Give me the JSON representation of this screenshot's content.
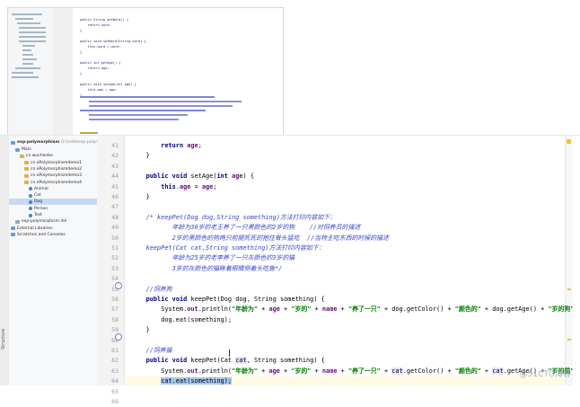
{
  "thumbnail": {
    "code_lines": [
      "public String getWord() {",
      "    return word;",
      "}",
      "public void setWord(String word) {",
      "    this.word = word;",
      "}",
      "public int getAge() {",
      "    return age;",
      "}",
      "public void setAge(int age) {",
      "    this.age = age;",
      "}"
    ]
  },
  "tree": {
    "project_name": "exp-polymorphism",
    "project_path": "D:\\code\\exp-polymorphism",
    "items": [
      {
        "label": "Main",
        "kind": "folder-blue",
        "indent": 1
      },
      {
        "label": "cn.wuchenbo",
        "kind": "folder",
        "indent": 2
      },
      {
        "label": "cn.ePolymorphismdemo1",
        "kind": "folder",
        "indent": 3
      },
      {
        "label": "cn.ePolymorphismdemo2",
        "kind": "folder",
        "indent": 3
      },
      {
        "label": "cn.ePolymorphismdemo3",
        "kind": "folder",
        "indent": 3
      },
      {
        "label": "cn.ePolymorphismdemo4",
        "kind": "folder",
        "indent": 3
      },
      {
        "label": "Animal",
        "kind": "class",
        "indent": 4
      },
      {
        "label": "Cat",
        "kind": "class",
        "indent": 4
      },
      {
        "label": "Dog",
        "kind": "class",
        "indent": 4,
        "selected": true
      },
      {
        "label": "Person",
        "kind": "class",
        "indent": 4
      },
      {
        "label": "Test",
        "kind": "class",
        "indent": 4
      },
      {
        "label": "exp-polymorphism.iml",
        "kind": "file",
        "indent": 1
      },
      {
        "label": "External Libraries",
        "kind": "folder-blue",
        "indent": 0
      },
      {
        "label": "Scratches and Consoles",
        "kind": "folder-blue",
        "indent": 0
      }
    ]
  },
  "side_label": "Structure",
  "editor": {
    "lines": [
      {
        "n": "41",
        "text": "        return age;"
      },
      {
        "n": "42",
        "text": "    }"
      },
      {
        "n": "43",
        "text": ""
      },
      {
        "n": "44",
        "text": "    public void setAge(int age) {"
      },
      {
        "n": "45",
        "text": "        this.age = age;"
      },
      {
        "n": "46",
        "text": "    }"
      },
      {
        "n": "47",
        "text": ""
      },
      {
        "n": "48",
        "text": "    /* keepPet(Dog dog,String something)方法打印内容如下："
      },
      {
        "n": "49",
        "text": "           年龄为30岁的老王养了一只黑颜色的2岁的狗    //对饲养员的描述"
      },
      {
        "n": "50",
        "text": "           2岁的黑颜色的狗两只前腿死死的抱住骨头猛吃  //当特主吃东西的时候的描述"
      },
      {
        "n": "51",
        "text": "    keepPet(Cat cat,String something)方法打印内容如下："
      },
      {
        "n": "52",
        "text": "           年龄为25岁的老李养了一只灰颜色的3岁的猫"
      },
      {
        "n": "53",
        "text": "           3岁的灰颜色的猫眯着眼睛侧着头吃鱼*/"
      },
      {
        "n": "54",
        "text": ""
      },
      {
        "n": "55",
        "text": "    //饲养狗"
      },
      {
        "n": "56",
        "text": "    public void keepPet(Dog dog, String something) {"
      },
      {
        "n": "57",
        "text": "        System.out.println(\"年龄为\" + age + \"岁的\" + name + \"养了一只\" + dog.getColor() + \"颜色的\" + dog.getAge() + \"岁的狗\");"
      },
      {
        "n": "58",
        "text": "        dog.eat(something);"
      },
      {
        "n": "59",
        "text": "    }"
      },
      {
        "n": "60",
        "text": ""
      },
      {
        "n": "61",
        "text": "    //饲养猫"
      },
      {
        "n": "62",
        "text": "    public void keepPet(Cat cat, String something) {"
      },
      {
        "n": "63",
        "text": "        System.out.println(\"年龄为\" + age + \"岁的\" + name + \"养了一只\" + cat.getColor() + \"颜色的\" + cat.getAge() + \"岁的猫\");"
      },
      {
        "n": "64",
        "text": "        cat.eat(something);"
      },
      {
        "n": "65",
        "text": "    }"
      },
      {
        "n": "66",
        "text": "}"
      }
    ]
  },
  "watermark": "@51CTO博客"
}
